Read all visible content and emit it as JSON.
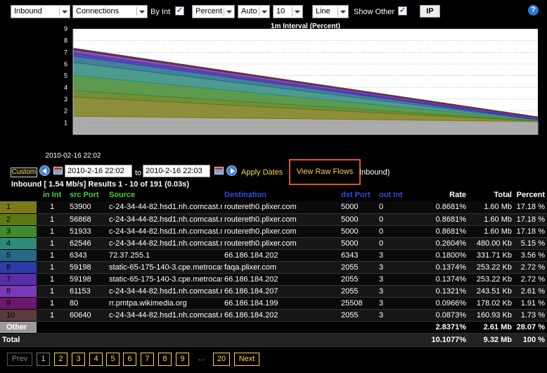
{
  "toolbar": {
    "direction": "Inbound",
    "metric": "Connections",
    "by_int_label": "By Int",
    "by_int_checked": "✓",
    "unit": "Percent",
    "scale": "Auto",
    "count": "10",
    "chart_type": "Line",
    "show_other_label": "Show Other",
    "show_other_checked": "✓",
    "ip_label": "IP",
    "help_label": "?"
  },
  "chart_data": {
    "type": "area",
    "title": "1m Interval (Percent)",
    "x": [
      "2010-02-16 22:02",
      "2010-02-16 22:03"
    ],
    "x_tick_label": "2010-02-16 22:02",
    "y_ticks": [
      "1",
      "2",
      "3",
      "4",
      "5",
      "6",
      "7",
      "8",
      "9"
    ],
    "ylim": [
      0,
      9
    ],
    "stacked": true,
    "grid": true,
    "series": [
      {
        "color": "#9e9e9e",
        "values": [
          1.55,
          1.1
        ]
      },
      {
        "color": "#7a7a18",
        "values": [
          1.65,
          0.03
        ]
      },
      {
        "color": "#5c7a14",
        "values": [
          0.55,
          0.03
        ]
      },
      {
        "color": "#3f8a2e",
        "values": [
          1.3,
          0.03
        ]
      },
      {
        "color": "#2e8a7a",
        "values": [
          1.1,
          0.04
        ]
      },
      {
        "color": "#246a86",
        "values": [
          0.55,
          0.04
        ]
      },
      {
        "color": "#2e3aa6",
        "values": [
          0.2,
          0.05
        ]
      },
      {
        "color": "#5a2ea6",
        "values": [
          0.12,
          0.05
        ]
      },
      {
        "color": "#7a3ab8",
        "values": [
          0.2,
          0.05
        ]
      },
      {
        "color": "#6a1a6a",
        "values": [
          0.07,
          0.04
        ]
      },
      {
        "color": "#5a3a3a",
        "values": [
          0.06,
          0.04
        ]
      }
    ]
  },
  "dates": {
    "custom_label": "Custom",
    "from": "2010-2-16 22:02",
    "to_label": "to",
    "to": "2010-2-16 22:03",
    "apply_label": "Apply Dates",
    "raw_flows_label": "View Raw Flows",
    "raw_flows_note": "Inbound)"
  },
  "summary": "Inbound [ 1.54 Mb/s] Results 1 - 10 of 191 (0.03s)",
  "table": {
    "headers": [
      {
        "label": "",
        "color": "#fff"
      },
      {
        "label": "in Int",
        "color": "#3fd13f"
      },
      {
        "label": "src Port",
        "color": "#3fd13f"
      },
      {
        "label": "Source",
        "color": "#3fd13f"
      },
      {
        "label": "Destination",
        "color": "#2f4fe0"
      },
      {
        "label": "dst Port",
        "color": "#2f4fe0"
      },
      {
        "label": "out Int",
        "color": "#2f4fe0"
      },
      {
        "label": "Rate",
        "color": "#fff"
      },
      {
        "label": "Total",
        "color": "#fff"
      },
      {
        "label": "Percent",
        "color": "#fff"
      }
    ],
    "rows": [
      {
        "n": "1",
        "color": "#7a7a18",
        "in_int": "1",
        "src_port": "53900",
        "source": "c-24-34-44-82.hsd1.nh.comcast.net",
        "destination": "routereth0.plixer.com",
        "dst_port": "5000",
        "out_int": "0",
        "rate": "0.8681%",
        "total": "1.60 Mb",
        "percent": "17.18 %"
      },
      {
        "n": "2",
        "color": "#5c7a14",
        "in_int": "1",
        "src_port": "56868",
        "source": "c-24-34-44-82.hsd1.nh.comcast.net",
        "destination": "routereth0.plixer.com",
        "dst_port": "5000",
        "out_int": "0",
        "rate": "0.8681%",
        "total": "1.60 Mb",
        "percent": "17.18 %"
      },
      {
        "n": "3",
        "color": "#3f8a2e",
        "in_int": "1",
        "src_port": "51933",
        "source": "c-24-34-44-82.hsd1.nh.comcast.net",
        "destination": "routereth0.plixer.com",
        "dst_port": "5000",
        "out_int": "0",
        "rate": "0.8681%",
        "total": "1.60 Mb",
        "percent": "17.18 %"
      },
      {
        "n": "4",
        "color": "#2e8a7a",
        "in_int": "1",
        "src_port": "62546",
        "source": "c-24-34-44-82.hsd1.nh.comcast.net",
        "destination": "routereth0.plixer.com",
        "dst_port": "5000",
        "out_int": "0",
        "rate": "0.2604%",
        "total": "480.00 Kb",
        "percent": "5.15 %"
      },
      {
        "n": "5",
        "color": "#246a86",
        "in_int": "1",
        "src_port": "6343",
        "source": "72.37.255.1",
        "destination": "66.186.184.202",
        "dst_port": "6343",
        "out_int": "3",
        "rate": "0.1800%",
        "total": "331.71 Kb",
        "percent": "3.56 %"
      },
      {
        "n": "6",
        "color": "#2e3aa6",
        "in_int": "1",
        "src_port": "59198",
        "source": "static-65-175-140-3.cpe.metrocast.net",
        "destination": "faqa.plixer.com",
        "dst_port": "2055",
        "out_int": "3",
        "rate": "0.1374%",
        "total": "253.22 Kb",
        "percent": "2.72 %"
      },
      {
        "n": "7",
        "color": "#5a2ea6",
        "in_int": "1",
        "src_port": "59198",
        "source": "static-65-175-140-3.cpe.metrocast.net",
        "destination": "66.186.184.202",
        "dst_port": "2055",
        "out_int": "3",
        "rate": "0.1374%",
        "total": "253.22 Kb",
        "percent": "2.72 %"
      },
      {
        "n": "8",
        "color": "#7a3ab8",
        "in_int": "1",
        "src_port": "61153",
        "source": "c-24-34-44-82.hsd1.nh.comcast.net",
        "destination": "66.186.184.207",
        "dst_port": "2055",
        "out_int": "3",
        "rate": "0.1321%",
        "total": "243.51 Kb",
        "percent": "2.61 %"
      },
      {
        "n": "9",
        "color": "#6a1a6a",
        "in_int": "1",
        "src_port": "80",
        "source": "rr.pmtpa.wikimedia.org",
        "destination": "66.186.184.199",
        "dst_port": "25508",
        "out_int": "3",
        "rate": "0.0966%",
        "total": "178.02 Kb",
        "percent": "1.91 %"
      },
      {
        "n": "10",
        "color": "#5a3a3a",
        "in_int": "1",
        "src_port": "60640",
        "source": "c-24-34-44-82.hsd1.nh.comcast.net",
        "destination": "66.186.184.202",
        "dst_port": "2055",
        "out_int": "3",
        "rate": "0.0873%",
        "total": "160.93 Kb",
        "percent": "1.73 %"
      }
    ],
    "other": {
      "label": "Other",
      "rate": "2.8371%",
      "total": "2.61 Mb",
      "percent": "28.07 %"
    },
    "total": {
      "label": "Total",
      "rate": "10.1077%",
      "total": "9.32 Mb",
      "percent": "100 %"
    }
  },
  "pager": {
    "prev": "Prev",
    "pages": [
      "1",
      "2",
      "3",
      "4",
      "5",
      "6",
      "7",
      "8",
      "9"
    ],
    "current": "1",
    "ellipsis": "...",
    "last": "20",
    "next": "Next"
  }
}
